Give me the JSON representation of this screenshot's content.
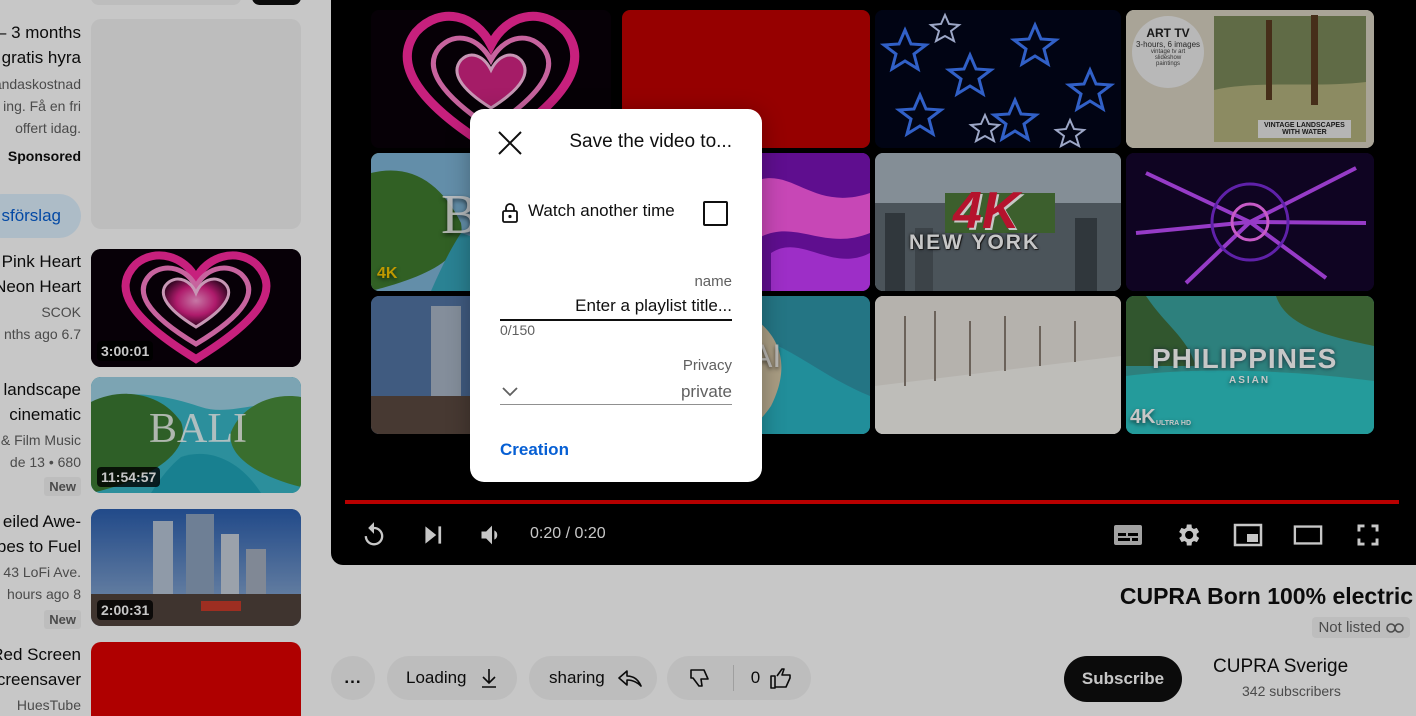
{
  "sidebar": {
    "ad": {
      "title_line1": "– 3 months",
      "title_line2": "gratis hyra",
      "desc_line1": "andaskostnad",
      "desc_line2": "ing. Få en fri",
      "desc_line3": "offert idag.",
      "sponsored": "Sponsored",
      "chip": "sförslag"
    },
    "videos": [
      {
        "title1": "Pink Heart",
        "title2": "Neon Heart",
        "meta1": "SCOK",
        "meta2": "nths ago 6.7",
        "duration": "3:00:01"
      },
      {
        "title1": "landscape",
        "title2": "cinematic",
        "meta1": "& Film Music",
        "meta2": "de 13 •  680",
        "badge": "New",
        "duration": "11:54:57",
        "thumb_text": "BALI"
      },
      {
        "title1": "eiled Awe-",
        "title2": "bes to Fuel",
        "meta1": "43 LoFi Ave.",
        "meta2": "hours ago 8",
        "badge": "New",
        "duration": "2:00:31"
      },
      {
        "title1": "Red Screen",
        "title2": "creensaver",
        "meta1": "HuesTube"
      }
    ]
  },
  "player": {
    "time": "0:20 / 0:20",
    "tiles": {
      "art_tv": "ART TV",
      "art_tv_sub": "3-hours, 6 images",
      "art_tv_note1": "vintage tv art",
      "art_tv_note2": "slideshow",
      "art_tv_note3": "paintings",
      "art_tv_badge1": "VINTAGE LANDSCAPES",
      "art_tv_badge2": "WITH WATER",
      "ny_4k": "4K",
      "ny": "NEW YORK",
      "bali": "BA",
      "ai": "AI",
      "ph": "PHILIPPINES",
      "ph_sub": "ASIAN",
      "ultra": "4K",
      "ultra_sub": "ULTRA HD"
    }
  },
  "video": {
    "title": "CUPRA Born 100% electric",
    "visibility": "Not listed",
    "channel": "CUPRA Sverige",
    "subscribers": "342 subscribers",
    "subscribe_label": "Subscribe",
    "more_label": "...",
    "download_label": "Loading",
    "share_label": "sharing",
    "like_count": "0"
  },
  "dialog": {
    "title": "Save the video to...",
    "watch_later": "Watch another time",
    "name_label": "name",
    "name_placeholder": "Enter a playlist title...",
    "counter": "0/150",
    "privacy_label": "Privacy",
    "privacy_value": "private",
    "create_label": "Creation"
  },
  "colors": {
    "accent_red": "#e00000",
    "link_blue": "#065fd4"
  }
}
